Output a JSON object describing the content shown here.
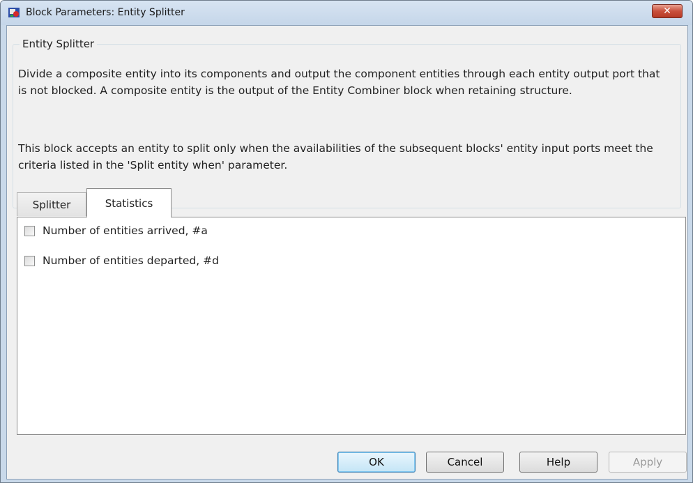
{
  "window": {
    "title": "Block Parameters: Entity Splitter",
    "close_glyph": "✕"
  },
  "group": {
    "legend": "Entity Splitter",
    "description_1": "Divide a composite entity into its components and output the component entities through each entity output port that is not blocked. A composite entity is the output of the Entity Combiner block when retaining structure.",
    "description_2": "This block accepts an entity to split only when the availabilities of the subsequent blocks' entity input ports meet the criteria listed in the 'Split entity when' parameter."
  },
  "tabs": [
    {
      "label": "Splitter",
      "active": false
    },
    {
      "label": "Statistics",
      "active": true
    }
  ],
  "statistics": {
    "options": [
      {
        "label": "Number of entities arrived, #a",
        "checked": false
      },
      {
        "label": "Number of entities departed, #d",
        "checked": false
      }
    ]
  },
  "buttons": {
    "ok": "OK",
    "cancel": "Cancel",
    "help": "Help",
    "apply": "Apply"
  },
  "colors": {
    "frame": "#c9d9ea",
    "close_button": "#c9503c",
    "ok_highlight": "#3c7fb1"
  }
}
